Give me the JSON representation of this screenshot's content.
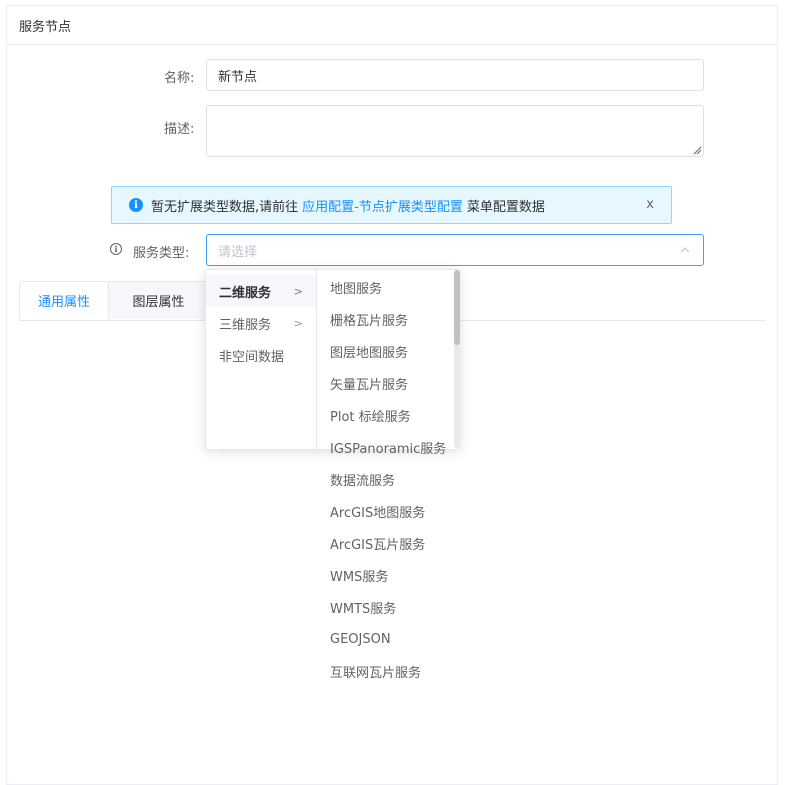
{
  "panel": {
    "title": "服务节点"
  },
  "form": {
    "name_label": "名称:",
    "name_value": "新节点",
    "desc_label": "描述:",
    "desc_value": "",
    "service_type_label": "服务类型:",
    "service_type_placeholder": "请选择"
  },
  "alert": {
    "text_before": "暂无扩展类型数据,请前往",
    "link": "应用配置-节点扩展类型配置",
    "text_after": "菜单配置数据",
    "close": "x"
  },
  "tabs": [
    {
      "label": "通用属性",
      "active": true
    },
    {
      "label": "图层属性",
      "active": false
    }
  ],
  "cascader": {
    "level1": [
      {
        "label": "二维服务",
        "active": true,
        "has_children": true
      },
      {
        "label": "三维服务",
        "active": false,
        "has_children": true
      },
      {
        "label": "非空间数据",
        "active": false,
        "has_children": false
      }
    ],
    "level2": [
      "地图服务",
      "栅格瓦片服务",
      "图层地图服务",
      "矢量瓦片服务",
      "Plot 标绘服务",
      "IGSPanoramic服务",
      "数据流服务",
      "ArcGIS地图服务",
      "ArcGIS瓦片服务",
      "WMS服务",
      "WMTS服务",
      "GEOJSON",
      "互联网瓦片服务"
    ],
    "chevron": ">"
  },
  "icons": {
    "info": "info-circle-icon",
    "help": "question-circle-icon",
    "close": "close-icon",
    "chevron_up": "chevron-up-icon",
    "chevron_right": "chevron-right-icon"
  },
  "colors": {
    "primary": "#1890ff",
    "alert_bg": "#e6f7ff",
    "alert_border": "#91d5ff",
    "select_border": "#409eff"
  }
}
